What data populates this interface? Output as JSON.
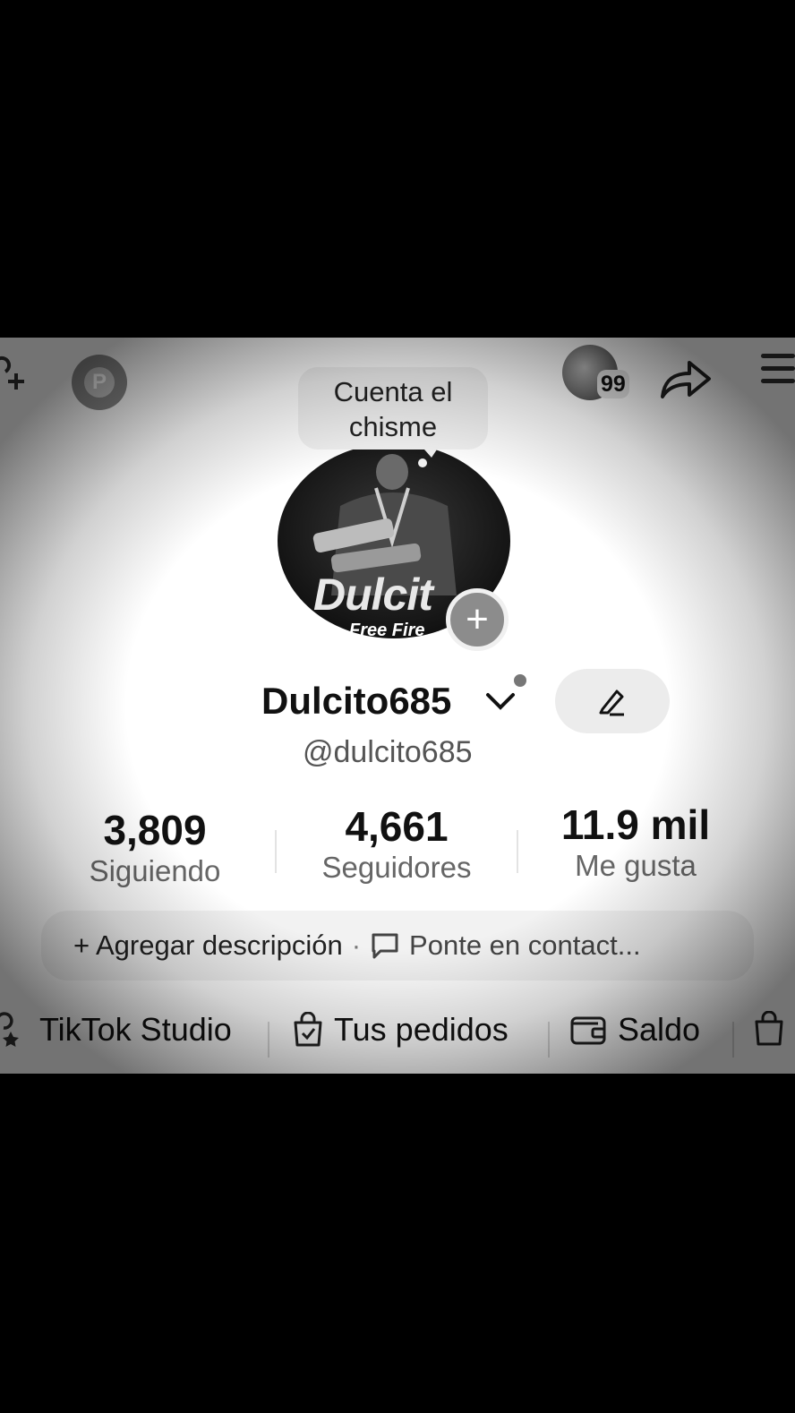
{
  "bubble": {
    "text_line1": "Cuenta el",
    "text_line2": "chisme"
  },
  "top_bar": {
    "p_badge": "P",
    "notification_count": "99"
  },
  "avatar": {
    "title": "Dulcit",
    "subtitle": "Free Fire"
  },
  "profile": {
    "display_name": "Dulcito685",
    "handle": "@dulcito685"
  },
  "stats": [
    {
      "value": "3,809",
      "label": "Siguiendo"
    },
    {
      "value": "4,661",
      "label": "Seguidores"
    },
    {
      "value": "11.9 mil",
      "label": "Me gusta"
    }
  ],
  "description": {
    "add_label": "+ Agregar descripción",
    "separator": "·",
    "contact_label": "Ponte en contact..."
  },
  "tools": [
    {
      "label": "TikTok Studio",
      "icon": "studio-icon"
    },
    {
      "label": "Tus pedidos",
      "icon": "shopping-bag-icon"
    },
    {
      "label": "Saldo",
      "icon": "wallet-icon"
    }
  ]
}
